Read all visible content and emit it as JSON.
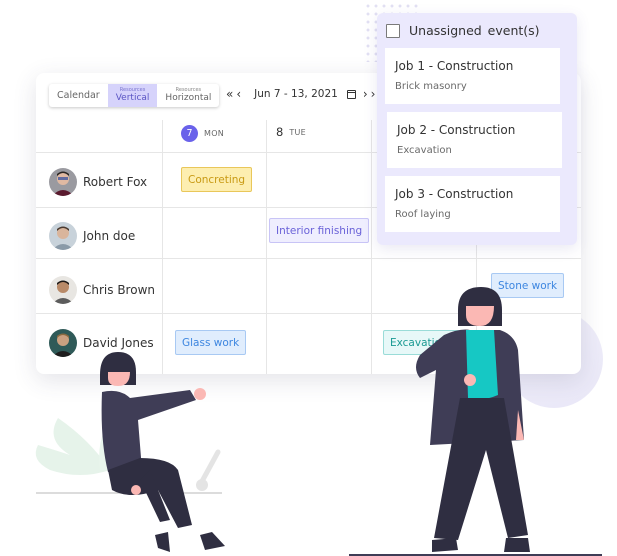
{
  "view_switcher": {
    "calendar": "Calendar",
    "resources_vertical_top": "Resources",
    "resources_vertical_main": "Vertical",
    "resources_horizontal_top": "Resources",
    "resources_horizontal_main": "Horizontal",
    "active": "Resources Vertical"
  },
  "navigation": {
    "prev_double_icon": "«",
    "prev_icon": "‹",
    "date_range": "Jun 7 - 13, 2021",
    "calendar_icon": "calendar-icon",
    "next_icon": "›",
    "next_double_icon": "›"
  },
  "days": [
    {
      "num": "7",
      "name": "MON",
      "today": true
    },
    {
      "num": "8",
      "name": "TUE",
      "today": false
    }
  ],
  "resources": [
    {
      "name": "Robert Fox"
    },
    {
      "name": "John doe"
    },
    {
      "name": "Chris Brown"
    },
    {
      "name": "David Jones"
    }
  ],
  "events": [
    {
      "label": "Concreting",
      "resource": "Robert Fox",
      "color": "yellow"
    },
    {
      "label": "Interior finishing",
      "resource": "John doe",
      "color": "purple"
    },
    {
      "label": "Stone work",
      "resource": "Chris Brown",
      "color": "blue"
    },
    {
      "label": "Glass work",
      "resource": "David Jones",
      "color": "blue"
    },
    {
      "label": "Excavation",
      "resource": "David Jones",
      "color": "teal"
    }
  ],
  "unassigned": {
    "title": "Unassigned  event(s)",
    "jobs": [
      {
        "title": "Job 1 - Construction",
        "subtitle": "Brick masonry"
      },
      {
        "title": "Job 2 - Construction",
        "subtitle": "Excavation"
      },
      {
        "title": "Job 3 - Construction",
        "subtitle": "Roof laying"
      }
    ]
  },
  "colors": {
    "accent": "#6a62ea",
    "panel_bg": "#ebe9fd",
    "figure_dark": "#2f2e41",
    "figure_jacket": "#3f3d56",
    "figure_top": "#16c8c4",
    "skin": "#fbb8b4"
  }
}
